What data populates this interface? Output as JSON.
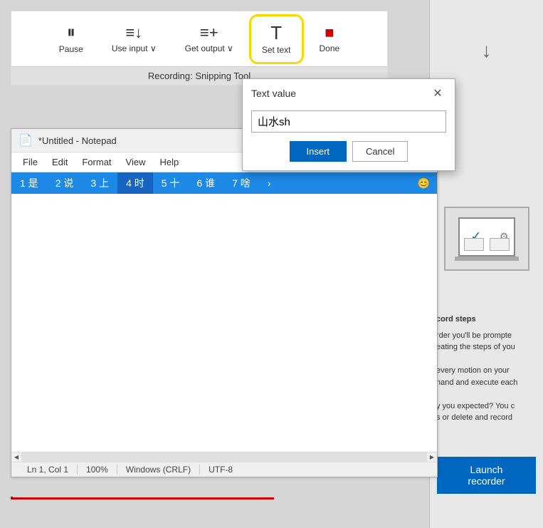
{
  "toolbar": {
    "pause_label": "Pause",
    "use_input_label": "Use input",
    "get_output_label": "Get output",
    "set_text_label": "Set text",
    "done_label": "Done",
    "recording_label": "Recording: Snipping Tool"
  },
  "dialog": {
    "title": "Text value",
    "input_value": "山水sh",
    "insert_label": "Insert",
    "cancel_label": "Cancel"
  },
  "notepad": {
    "title": "*Untitled - Notepad",
    "menu": {
      "file": "File",
      "edit": "Edit",
      "format": "Format",
      "view": "View",
      "help": "Help"
    },
    "ime_items": [
      {
        "label": "1 是",
        "active": false
      },
      {
        "label": "2 说",
        "active": false
      },
      {
        "label": "3 上",
        "active": false
      },
      {
        "label": "4 时",
        "active": true
      },
      {
        "label": "5 十",
        "active": false
      },
      {
        "label": "6 谁",
        "active": false
      },
      {
        "label": "7 啥",
        "active": false
      }
    ],
    "statusbar": {
      "position": "Ln 1, Col 1",
      "zoom": "100%",
      "line_ending": "Windows (CRLF)",
      "encoding": "UTF-8"
    }
  },
  "right_panel": {
    "steps_title": "cord steps",
    "steps_text1": "rder you'll be prompte",
    "steps_text2": "eating the steps of you",
    "steps_text3": "every motion on your",
    "steps_text4": "hand and execute each",
    "steps_text5": "y you expected? You c",
    "steps_text6": "s or delete and record"
  },
  "launch_recorder": {
    "label": "Launch recorder"
  }
}
